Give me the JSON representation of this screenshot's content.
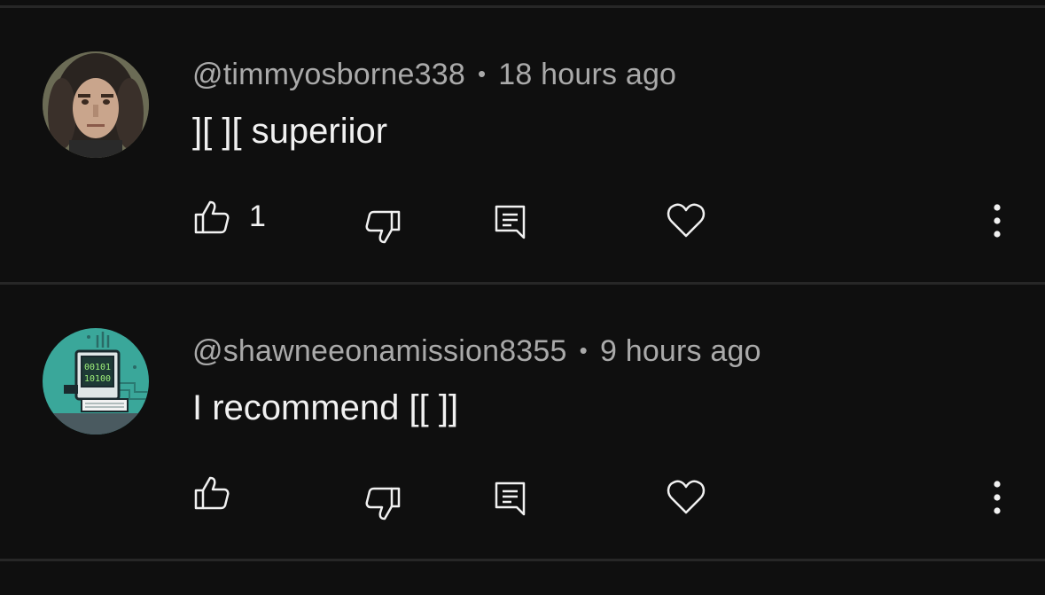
{
  "comments": [
    {
      "author": "@timmyosborne338",
      "time": "18 hours ago",
      "separator": "•",
      "text": "][ ][ superiior",
      "like_count": "1",
      "avatar_icon": "person-photo-avatar"
    },
    {
      "author": "@shawneeonamission8355",
      "time": "9 hours ago",
      "separator": "•",
      "text": "I recommend [[ ]]",
      "like_count": "",
      "avatar_icon": "computer-terminal-avatar",
      "avatar_screen_text": [
        "00101",
        "10100"
      ]
    }
  ],
  "colors": {
    "background": "#0f0f0f",
    "divider": "#272727",
    "meta_text": "#aaaaaa",
    "body_text": "#f1f1f1",
    "icon": "#f1f1f1"
  }
}
